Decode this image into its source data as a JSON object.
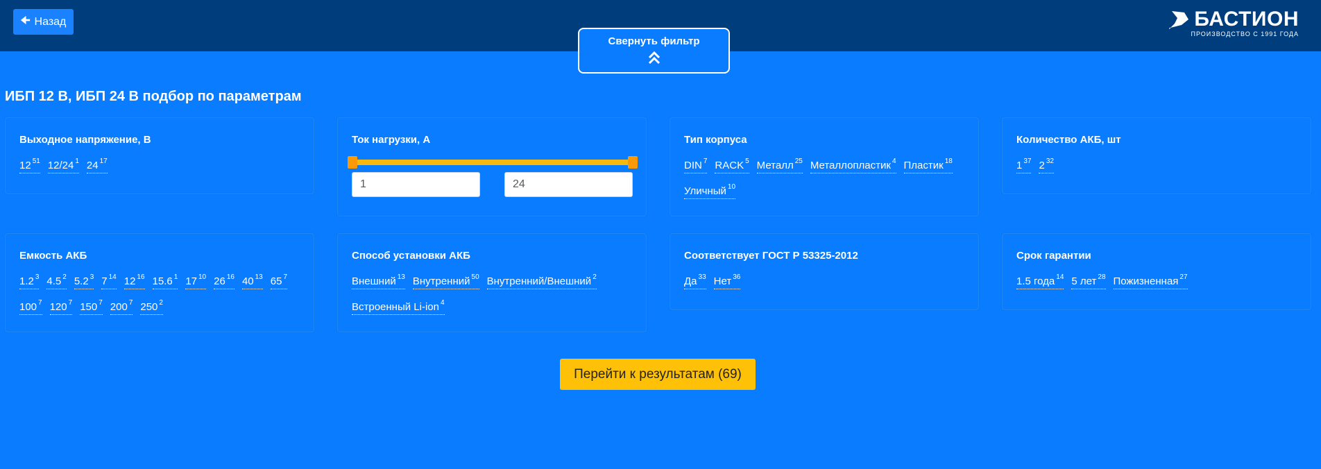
{
  "header": {
    "back_label": "Назад",
    "collapse_label": "Свернуть фильтр",
    "logo_name": "БАСТИОН",
    "logo_sub": "ПРОИЗВОДСТВО С 1991 ГОДА"
  },
  "page_title": "ИБП 12 В, ИБП 24 В подбор по параметрам",
  "filters": {
    "voltage": {
      "title": "Выходное напряжение, В",
      "options": [
        {
          "label": "12",
          "count": "51"
        },
        {
          "label": "12/24",
          "count": "1"
        },
        {
          "label": "24",
          "count": "17"
        }
      ]
    },
    "current": {
      "title": "Ток нагрузки, А",
      "min_value": "1",
      "max_value": "24"
    },
    "case_type": {
      "title": "Тип корпуса",
      "options": [
        {
          "label": "DIN",
          "count": "7"
        },
        {
          "label": "RACK",
          "count": "5"
        },
        {
          "label": "Металл",
          "count": "25"
        },
        {
          "label": "Металлопластик",
          "count": "4"
        },
        {
          "label": "Пластик",
          "count": "18"
        },
        {
          "label": "Уличный",
          "count": "10"
        }
      ]
    },
    "battery_count": {
      "title": "Количество АКБ, шт",
      "options": [
        {
          "label": "1",
          "count": "37"
        },
        {
          "label": "2",
          "count": "32"
        }
      ]
    },
    "battery_capacity": {
      "title": "Емкость АКБ",
      "options": [
        {
          "label": "1.2",
          "count": "3"
        },
        {
          "label": "4.5",
          "count": "2"
        },
        {
          "label": "5.2",
          "count": "3"
        },
        {
          "label": "7",
          "count": "14"
        },
        {
          "label": "12",
          "count": "16"
        },
        {
          "label": "15.6",
          "count": "1"
        },
        {
          "label": "17",
          "count": "10"
        },
        {
          "label": "26",
          "count": "16"
        },
        {
          "label": "40",
          "count": "13"
        },
        {
          "label": "65",
          "count": "7"
        },
        {
          "label": "100",
          "count": "7"
        },
        {
          "label": "120",
          "count": "7"
        },
        {
          "label": "150",
          "count": "7"
        },
        {
          "label": "200",
          "count": "7"
        },
        {
          "label": "250",
          "count": "2"
        }
      ]
    },
    "battery_mount": {
      "title": "Способ установки АКБ",
      "options": [
        {
          "label": "Внешний",
          "count": "13"
        },
        {
          "label": "Внутренний",
          "count": "50"
        },
        {
          "label": "Внутренний/Внешний",
          "count": "2"
        },
        {
          "label": "Встроенный Li-ion",
          "count": "4"
        }
      ]
    },
    "gost": {
      "title": "Соответствует ГОСТ Р 53325-2012",
      "options": [
        {
          "label": "Да",
          "count": "33"
        },
        {
          "label": "Нет",
          "count": "36"
        }
      ]
    },
    "warranty": {
      "title": "Срок гарантии",
      "options": [
        {
          "label": "1.5 года",
          "count": "14"
        },
        {
          "label": "5 лет",
          "count": "28"
        },
        {
          "label": "Пожизненная",
          "count": "27"
        }
      ]
    }
  },
  "results_button": "Перейти к результатам (69)",
  "colors": {
    "background": "#0a7cff",
    "header": "#003d7d",
    "accent": "#ffc107",
    "slider": "#f8b80e"
  }
}
